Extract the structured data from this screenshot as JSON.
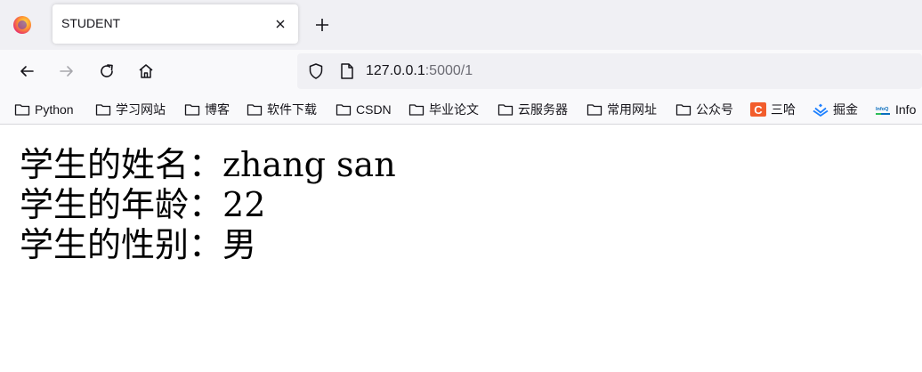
{
  "browser": {
    "tab": {
      "title": "STUDENT"
    },
    "url": {
      "host": "127.0.0.1",
      "path": ":5000/1"
    }
  },
  "bookmarks": [
    {
      "label": "Python",
      "icon": "folder-icon"
    },
    {
      "label": "学习网站",
      "icon": "folder-icon"
    },
    {
      "label": "博客",
      "icon": "folder-icon"
    },
    {
      "label": "软件下载",
      "icon": "folder-icon"
    },
    {
      "label": "CSDN",
      "icon": "folder-icon"
    },
    {
      "label": "毕业论文",
      "icon": "folder-icon"
    },
    {
      "label": "云服务器",
      "icon": "folder-icon"
    },
    {
      "label": "常用网址",
      "icon": "folder-icon"
    },
    {
      "label": "公众号",
      "icon": "folder-icon"
    },
    {
      "label": "三哈",
      "icon": "csdn-c-icon",
      "icon_text": "C"
    },
    {
      "label": "掘金",
      "icon": "juejin-icon"
    },
    {
      "label": "Info",
      "icon": "infoq-icon",
      "icon_text": "InfoQ"
    }
  ],
  "student": {
    "name_label": "学生的姓名：",
    "name": "zhang san",
    "age_label": "学生的年龄：",
    "age": "22",
    "gender_label": "学生的性别：",
    "gender": "男"
  },
  "colors": {
    "tabstrip": "#f0f0f4",
    "toolbar": "#f9f9fb",
    "csdn": "#f25d2c",
    "juejin": "#1e80ff"
  }
}
